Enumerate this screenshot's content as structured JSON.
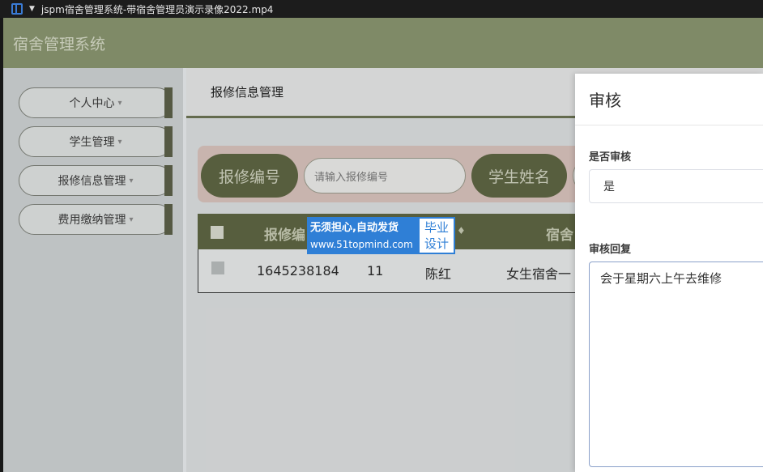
{
  "player": {
    "title": "jspm宿舍管理系统-带宿舍管理员演示录像2022.mp4"
  },
  "app": {
    "title": "宿舍管理系统"
  },
  "sidebar": {
    "items": [
      {
        "label": "个人中心"
      },
      {
        "label": "学生管理"
      },
      {
        "label": "报修信息管理"
      },
      {
        "label": "费用缴纳管理"
      }
    ],
    "caret": "▾"
  },
  "main": {
    "breadcrumb": "报修信息管理",
    "search": {
      "label1": "报修编号",
      "placeholder1": "请输入报修编号",
      "label2": "学生姓名"
    },
    "table": {
      "headers": [
        "报修编",
        "宿舍"
      ],
      "sort_glyph": "♦",
      "rows": [
        {
          "id": "1645238184",
          "col2": "11",
          "name": "陈红",
          "dorm": "女生宿舍一"
        }
      ]
    }
  },
  "watermark": {
    "line1": "无须担心,自动发货",
    "line2": "www.51topmind.com",
    "right1": "毕业",
    "right2": "设计"
  },
  "drawer": {
    "title": "审核",
    "approve_label": "是否审核",
    "approve_value": "是",
    "reply_label": "审核回复",
    "reply_value": "会于星期六上午去维修"
  }
}
